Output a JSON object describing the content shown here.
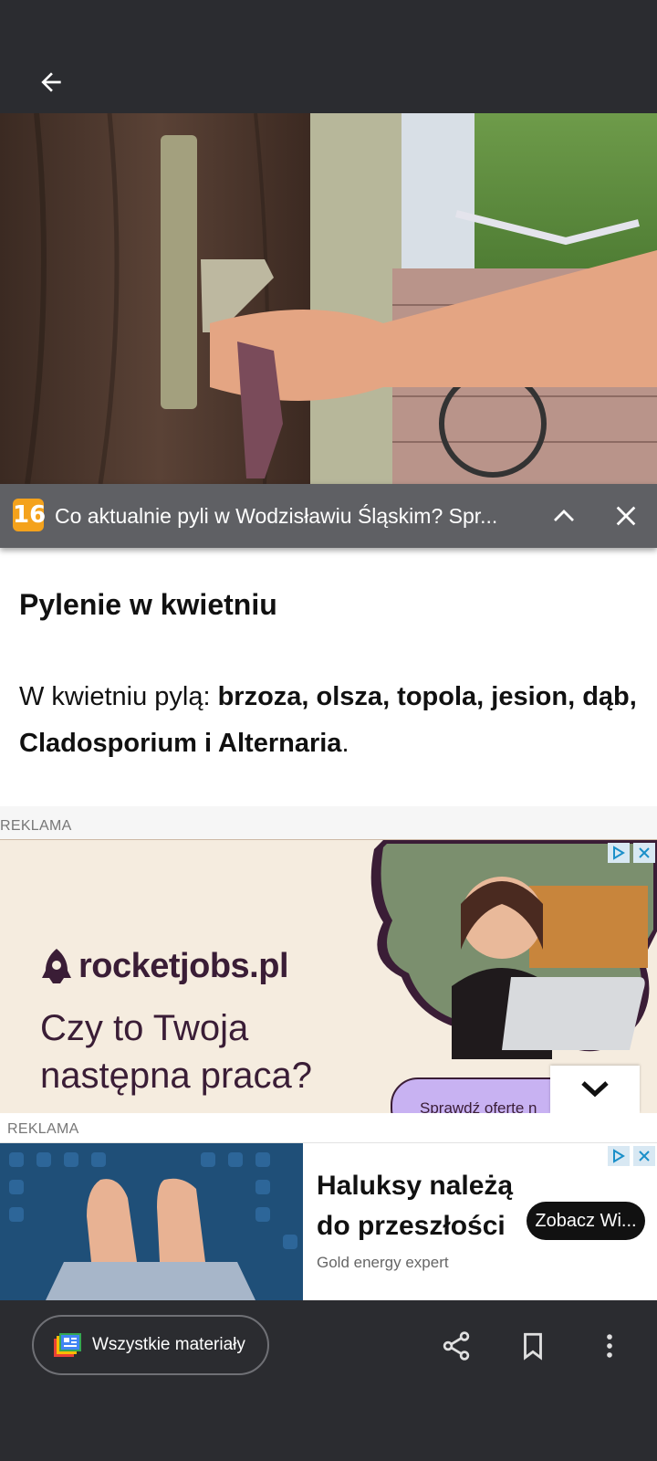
{
  "top_bar": {
    "back_icon": "arrow-left-icon"
  },
  "notification": {
    "badge": "16",
    "title": "Co aktualnie pyli w Wodzisławiu Śląskim? Spr...",
    "expand_icon": "chevron-up-icon",
    "close_icon": "close-icon"
  },
  "article": {
    "heading": "Pylenie w kwietniu",
    "paragraph_prefix": "W kwietniu pylą: ",
    "paragraph_bold": "brzoza, olsza, topola, jesion, dąb, Cladosporium i Alternaria",
    "paragraph_suffix": "."
  },
  "ad1": {
    "label": "REKLAMA",
    "brand": "rocketjobs.pl",
    "headline": "Czy to Twoja następna praca?",
    "cta": "Sprawdź oferte n",
    "collapse_icon": "chevron-down-icon",
    "colors": {
      "background": "#f5ecdf",
      "text": "#3a1d36",
      "cta": "#c8b2f2"
    }
  },
  "ad2": {
    "label": "REKLAMA",
    "headline": "Haluksy należą do przeszłości",
    "advertiser": "Gold energy expert",
    "cta": "Zobacz Wi..."
  },
  "bottom_bar": {
    "all_materials": "Wszystkie materiały",
    "share_icon": "share-icon",
    "bookmark_icon": "bookmark-icon",
    "more_icon": "more-vertical-icon"
  }
}
